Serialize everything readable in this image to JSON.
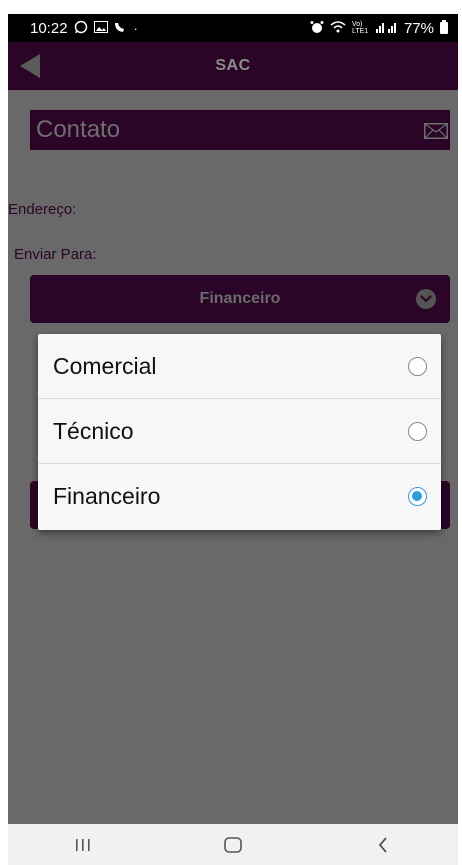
{
  "status_bar": {
    "time": "10:22",
    "battery": "77%",
    "signal_label": "Vo) LTE1"
  },
  "app_bar": {
    "title": "SAC"
  },
  "contact": {
    "title": "Contato"
  },
  "form": {
    "address_label": "Endereço:",
    "send_to_label": "Enviar Para:",
    "selected_value": "Financeiro"
  },
  "dropdown": {
    "options": [
      {
        "label": "Comercial",
        "selected": false
      },
      {
        "label": "Técnico",
        "selected": false
      },
      {
        "label": "Financeiro",
        "selected": true
      }
    ]
  },
  "colors": {
    "brand": "#2a0527",
    "overlay": "#696969",
    "radio_selected": "#2e9bdc"
  }
}
